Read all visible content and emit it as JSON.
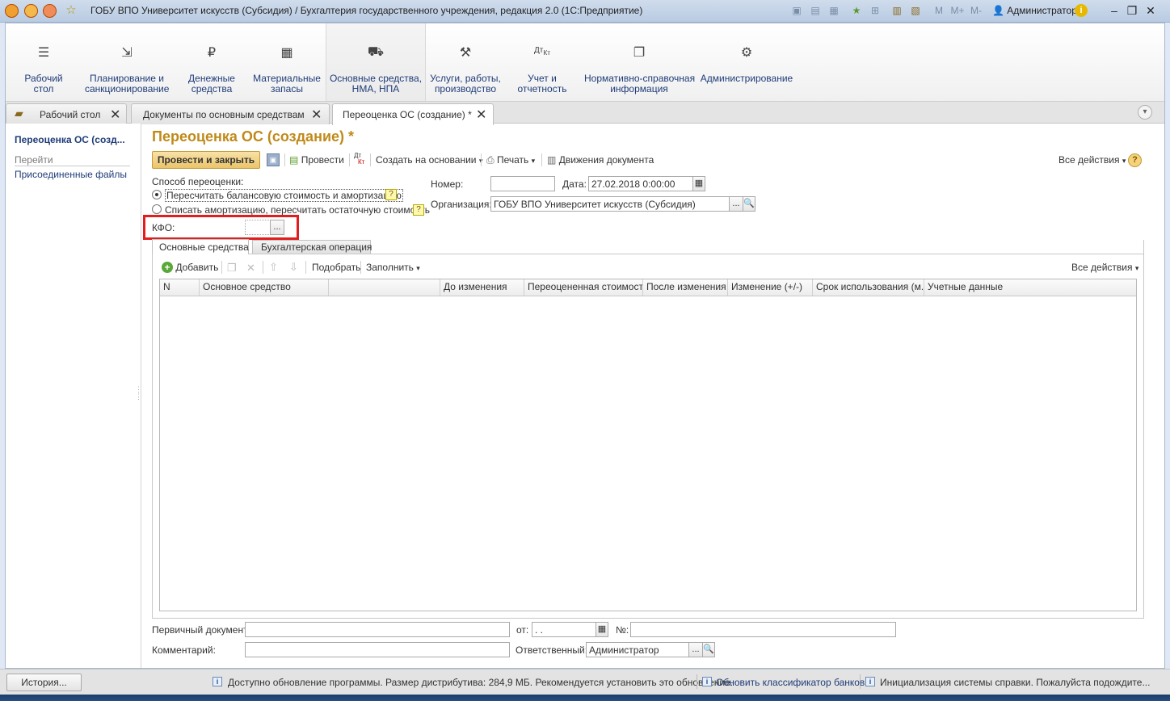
{
  "window": {
    "title": "ГОБУ ВПО Университет искусств (Субсидия) / Бухгалтерия государственного учреждения, редакция 2.0  (1С:Предприятие)",
    "user": "Администратор",
    "m_labels": [
      "M",
      "M+",
      "M-"
    ]
  },
  "sections": [
    {
      "label": "Рабочий\nстол",
      "icon": "menu-icon"
    },
    {
      "label": "Планирование и\nсанкционирование",
      "icon": "planning-icon"
    },
    {
      "label": "Денежные\nсредства",
      "icon": "ruble-icon"
    },
    {
      "label": "Материальные\nзапасы",
      "icon": "grid-icon"
    },
    {
      "label": "Основные средства,\nНМА, НПА",
      "icon": "truck-icon"
    },
    {
      "label": "Услуги, работы,\nпроизводство",
      "icon": "tools-icon"
    },
    {
      "label": "Учет и\nотчетность",
      "icon": "dt-kt-icon"
    },
    {
      "label": "Нормативно-справочная\nинформация",
      "icon": "books-icon"
    },
    {
      "label": "Администрирование",
      "icon": "gear-icon"
    }
  ],
  "open_tabs": [
    {
      "label": "Рабочий стол"
    },
    {
      "label": "Документы по основным средствам"
    },
    {
      "label": "Переоценка ОС (создание) *"
    }
  ],
  "leftnav": {
    "title": "Переоценка ОС (созд...",
    "goto": "Перейти",
    "attached_files": "Присоединенные файлы"
  },
  "form": {
    "title": "Переоценка ОС (создание) *",
    "toolbar": {
      "post_and_close": "Провести и закрыть",
      "post": "Провести",
      "create_based_on": "Создать на основании",
      "print": "Печать",
      "movements": "Движения документа",
      "all_actions": "Все действия"
    },
    "method_label": "Способ переоценки:",
    "method_options": [
      {
        "label": "Пересчитать балансовую стоимость и амортизацию",
        "selected": true
      },
      {
        "label": "Списать амортизацию, пересчитать остаточную стоимость",
        "selected": false
      }
    ],
    "number_label": "Номер:",
    "number_value": "",
    "date_label": "Дата:",
    "date_value": "27.02.2018  0:00:00",
    "org_label": "Организация:",
    "org_value": "ГОБУ ВПО Университет искусств (Субсидия)",
    "kfo_label": "КФО:",
    "kfo_value": "",
    "help_mark": "?",
    "ellipsis": "...",
    "inner_tabs": [
      "Основные средства",
      "Бухгалтерская операция"
    ],
    "table_toolbar": {
      "add": "Добавить",
      "pick": "Подобрать",
      "fill": "Заполнить",
      "all_actions": "Все действия"
    },
    "table_columns": [
      "N",
      "Основное средство",
      "",
      "До изменения",
      "Переоцененная стоимость",
      "После изменения",
      "Изменение (+/-)",
      "Срок использования (м...",
      "Учетные данные"
    ],
    "primary_doc_label": "Первичный документ:",
    "primary_doc_value": "",
    "from_label": "от:",
    "from_value": " .  .",
    "no_label": "№:",
    "no_value": "",
    "comment_label": "Комментарий:",
    "comment_value": "",
    "responsible_label": "Ответственный:",
    "responsible_value": "Администратор"
  },
  "status": {
    "history_button": "История...",
    "message1": "Доступно обновление программы. Размер дистрибутива: 284,9 МБ. Рекомендуется установить это обновление.",
    "message2": "Обновить классификатор банков",
    "message3": "Инициализация системы справки. Пожалуйста подождите..."
  },
  "colors": {
    "accent_title": "#c08a1a",
    "highlight_box": "#e01e1e",
    "primary_button": "#f2d38a",
    "link": "#1f3c78"
  }
}
